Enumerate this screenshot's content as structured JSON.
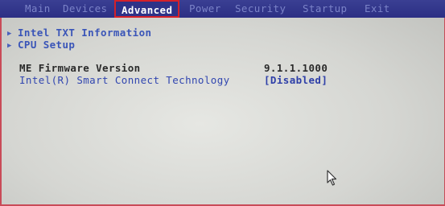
{
  "menu": {
    "tabs": [
      {
        "label": "Main"
      },
      {
        "label": "Devices"
      },
      {
        "label": "Advanced"
      },
      {
        "label": "Power"
      },
      {
        "label": "Security"
      },
      {
        "label": "Startup"
      },
      {
        "label": "Exit"
      }
    ],
    "active_tab": "Advanced"
  },
  "advanced": {
    "submenus": [
      {
        "label": "Intel TXT Information"
      },
      {
        "label": "CPU Setup"
      }
    ],
    "me_firmware": {
      "label": "ME Firmware Version",
      "value": "9.1.1.1000"
    },
    "smart_connect": {
      "label": "Intel(R) Smart Connect Technology",
      "value": "[Disabled]"
    }
  },
  "colors": {
    "menubar_bg": "#2c2f84",
    "tab_text": "#7b83c8",
    "active_tab_text": "#ffffff",
    "active_tab_border": "#d4212a",
    "submenu_text": "#3a55b8",
    "static_text": "#2a2a2a",
    "setting_text": "#3146b0",
    "background": "#d7d8d4"
  },
  "icons": {
    "submenu_marker": "triangle-right-icon",
    "pointer": "mouse-pointer-icon"
  }
}
